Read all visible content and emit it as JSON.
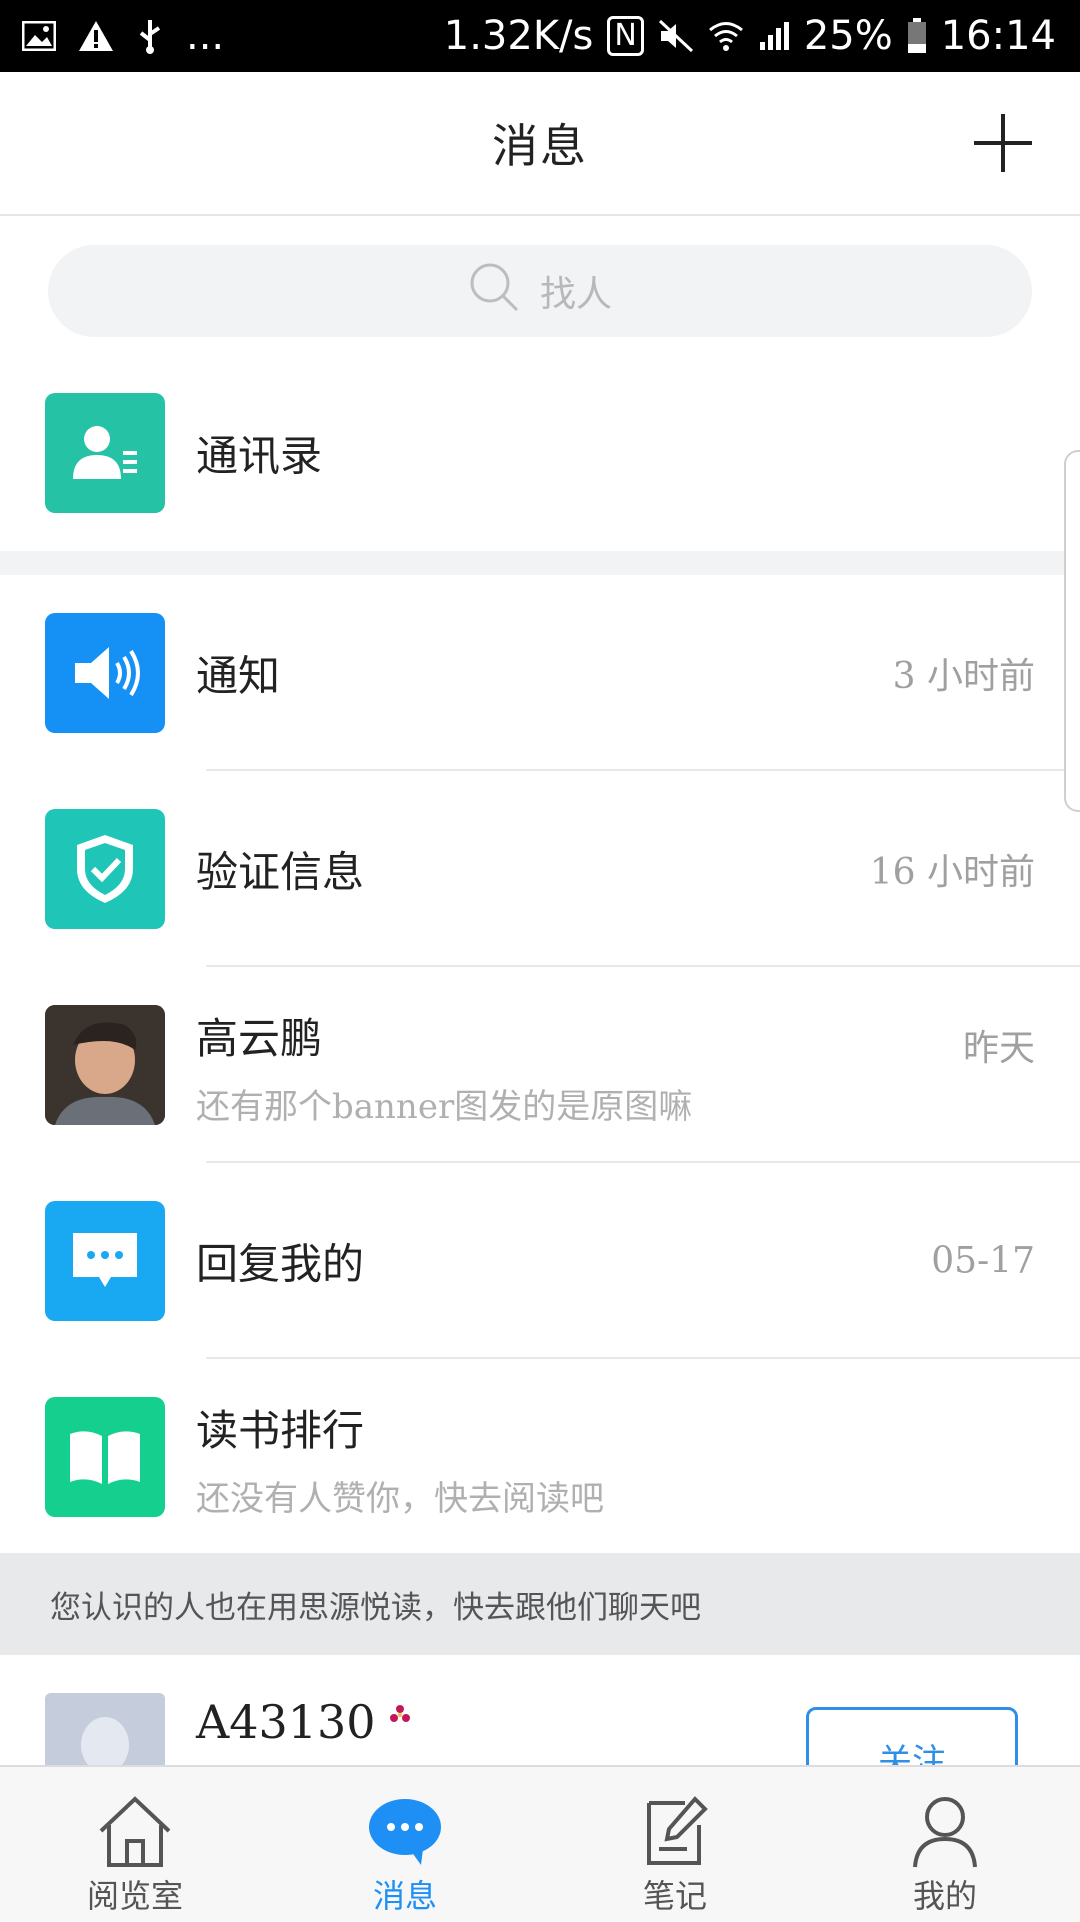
{
  "status_bar": {
    "left_more": "...",
    "speed": "1.32K/s",
    "nfc": "N",
    "battery": "25%",
    "time": "16:14"
  },
  "header": {
    "title": "消息"
  },
  "search": {
    "placeholder": "找人"
  },
  "contacts": {
    "label": "通讯录"
  },
  "messages": [
    {
      "title": "通知",
      "time": "3 小时前"
    },
    {
      "title": "验证信息",
      "time": "16 小时前"
    },
    {
      "title": "高云鹏",
      "time": "昨天",
      "preview": "还有那个banner图发的是原图嘛"
    },
    {
      "title": "回复我的",
      "time": "05-17"
    },
    {
      "title": "读书排行",
      "preview": "还没有人赞你，快去阅读吧"
    }
  ],
  "banner": {
    "text": "您认识的人也在用思源悦读，快去跟他们聊天吧"
  },
  "suggestion": {
    "name": "A43130",
    "follow_label": "关注"
  },
  "tabs": [
    {
      "label": "阅览室",
      "icon": "home-icon"
    },
    {
      "label": "消息",
      "icon": "chat-bubble-icon"
    },
    {
      "label": "笔记",
      "icon": "note-icon"
    },
    {
      "label": "我的",
      "icon": "person-icon"
    }
  ],
  "colors": {
    "accent": "#1e8ff5",
    "teal": "#26c2a6",
    "blue": "#1591f5",
    "green": "#14cf8e"
  }
}
